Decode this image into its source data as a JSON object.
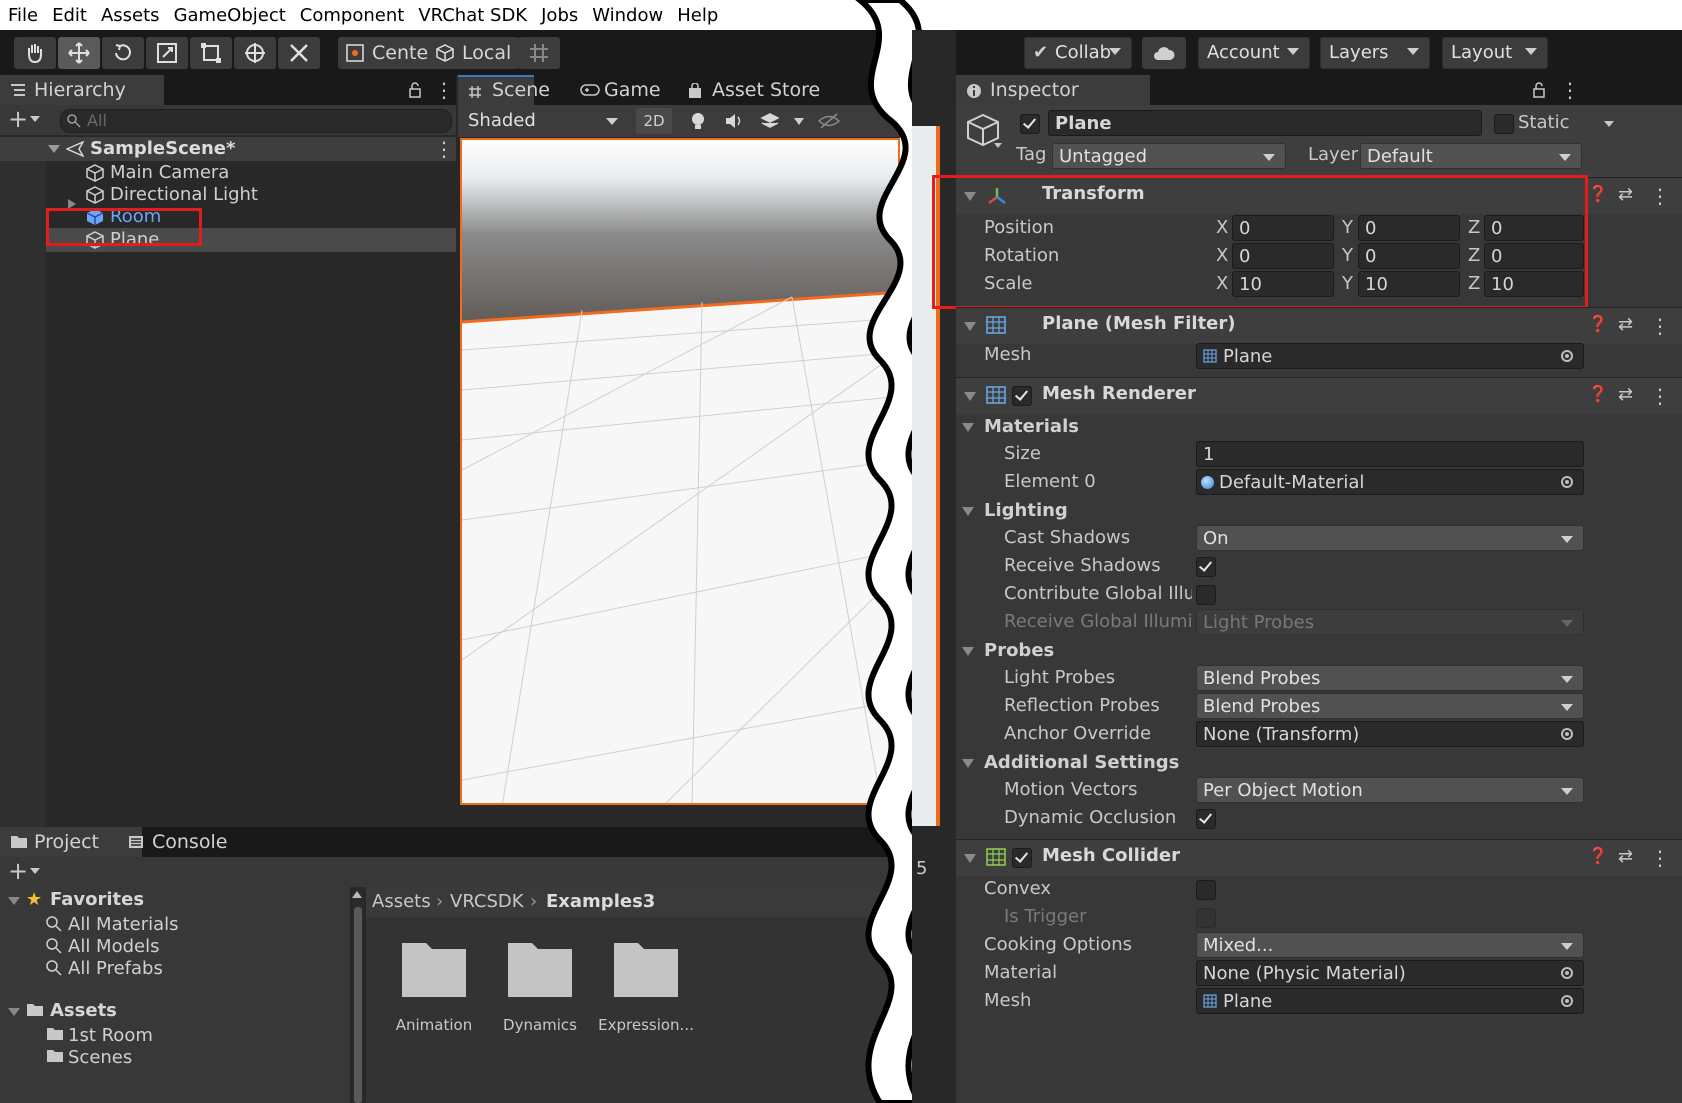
{
  "menu": [
    "File",
    "Edit",
    "Assets",
    "GameObject",
    "Component",
    "VRChat SDK",
    "Jobs",
    "Window",
    "Help"
  ],
  "toolbar": {
    "center": "Center",
    "local": "Local",
    "collab": "Collab",
    "account": "Account",
    "layers": "Layers",
    "layout": "Layout"
  },
  "hierarchy": {
    "tab": "Hierarchy",
    "search_placeholder": "All",
    "scene": "SampleScene*",
    "items": [
      "Main Camera",
      "Directional Light",
      "Room",
      "Plane"
    ]
  },
  "scene_view": {
    "tabs": [
      "Scene",
      "Game",
      "Asset Store"
    ],
    "shading": "Shaded",
    "mode_2d": "2D"
  },
  "bottom": {
    "tabs": [
      "Project",
      "Console"
    ],
    "favorites": "Favorites",
    "favorite_items": [
      "All Materials",
      "All Models",
      "All Prefabs"
    ],
    "assets": "Assets",
    "asset_items": [
      "1st Room",
      "Scenes"
    ],
    "breadcrumb": [
      "Assets",
      "VRCSDK",
      "Examples3"
    ],
    "folders": [
      "Animation",
      "Dynamics",
      "Expression..."
    ],
    "edge_number": "5"
  },
  "inspector": {
    "tab": "Inspector",
    "object_name": "Plane",
    "static_label": "Static",
    "tag_label": "Tag",
    "tag": "Untagged",
    "layer_label": "Layer",
    "layer": "Default",
    "transform": {
      "title": "Transform",
      "rows": [
        {
          "label": "Position",
          "x": "0",
          "y": "0",
          "z": "0"
        },
        {
          "label": "Rotation",
          "x": "0",
          "y": "0",
          "z": "0"
        },
        {
          "label": "Scale",
          "x": "10",
          "y": "10",
          "z": "10"
        }
      ],
      "axes": [
        "X",
        "Y",
        "Z"
      ]
    },
    "mesh_filter": {
      "title": "Plane (Mesh Filter)",
      "mesh_label": "Mesh",
      "mesh": "Plane"
    },
    "mesh_renderer": {
      "title": "Mesh Renderer",
      "materials": "Materials",
      "size_label": "Size",
      "size": "1",
      "element0_label": "Element 0",
      "element0": "Default-Material",
      "lighting": "Lighting",
      "cast_shadows_label": "Cast Shadows",
      "cast_shadows": "On",
      "receive_shadows_label": "Receive Shadows",
      "contribute_gi_label": "Contribute Global Illumina",
      "receive_gi_label": "Receive Global Illuminati",
      "receive_gi": "Light Probes",
      "probes": "Probes",
      "light_probes_label": "Light Probes",
      "light_probes": "Blend Probes",
      "reflection_probes_label": "Reflection Probes",
      "reflection_probes": "Blend Probes",
      "anchor_override_label": "Anchor Override",
      "anchor_override": "None (Transform)",
      "additional": "Additional Settings",
      "motion_vectors_label": "Motion Vectors",
      "motion_vectors": "Per Object Motion",
      "dynamic_occlusion_label": "Dynamic Occlusion"
    },
    "mesh_collider": {
      "title": "Mesh Collider",
      "convex_label": "Convex",
      "is_trigger_label": "Is Trigger",
      "cooking_label": "Cooking Options",
      "cooking": "Mixed...",
      "material_label": "Material",
      "material": "None (Physic Material)",
      "mesh_label": "Mesh",
      "mesh": "Plane"
    }
  },
  "colors": {
    "highlight": "#e01e1e",
    "scene_border": "#f26b1d",
    "link": "#6ba4ff"
  }
}
